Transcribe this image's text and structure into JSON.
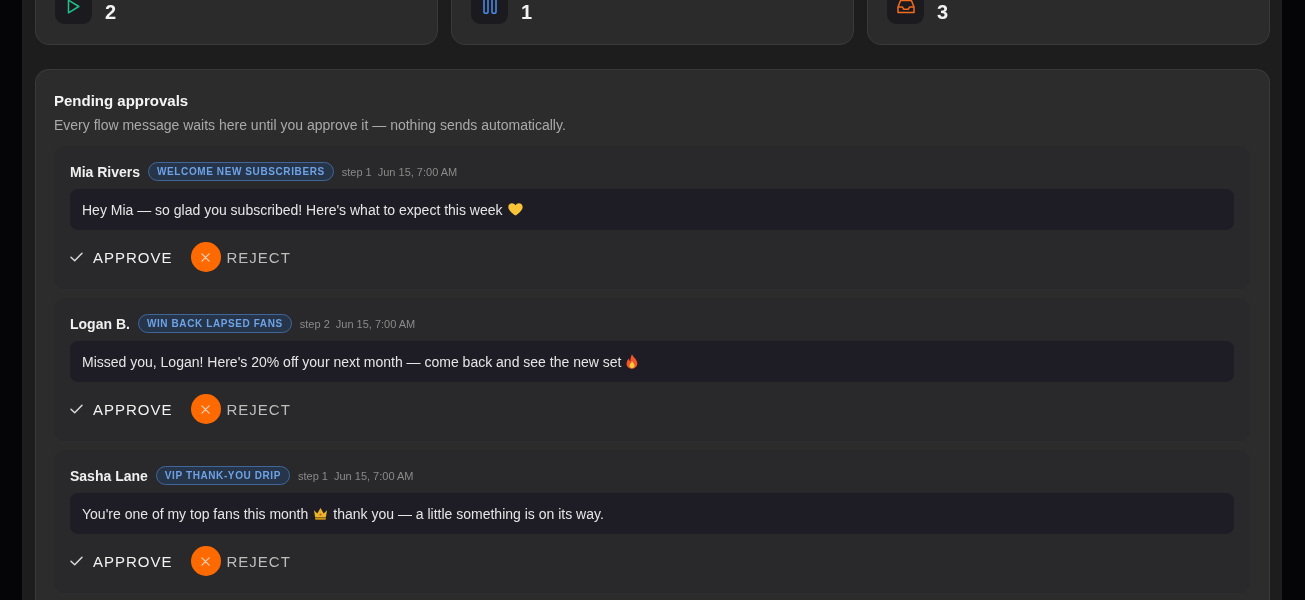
{
  "stats": [
    {
      "kind": "play",
      "value": "2"
    },
    {
      "kind": "pause",
      "value": "1"
    },
    {
      "kind": "inbox",
      "value": "3"
    }
  ],
  "pending": {
    "title": "Pending approvals",
    "subtitle": "Every flow message waits here until you approve it — nothing sends automatically.",
    "items": [
      {
        "name": "Mia Rivers",
        "flow": "WELCOME NEW SUBSCRIBERS",
        "step": "step 1",
        "time": "Jun 15, 7:00 AM",
        "message": [
          {
            "kind": "text",
            "text": "Hey Mia — so glad you subscribed! Here's what to expect this week"
          },
          {
            "kind": "heart"
          }
        ],
        "actions": [
          {
            "kind": "approve",
            "label": "APPROVE"
          },
          {
            "kind": "reject",
            "label": "REJECT"
          }
        ]
      },
      {
        "name": "Logan B.",
        "flow": "WIN BACK LAPSED FANS",
        "step": "step 2",
        "time": "Jun 15, 7:00 AM",
        "message": [
          {
            "kind": "text",
            "text": "Missed you, Logan! Here's 20% off your next month — come back and see the new set"
          },
          {
            "kind": "fire"
          }
        ],
        "actions": [
          {
            "kind": "approve",
            "label": "APPROVE"
          },
          {
            "kind": "reject",
            "label": "REJECT"
          }
        ]
      },
      {
        "name": "Sasha Lane",
        "flow": "VIP THANK-YOU DRIP",
        "step": "step 1",
        "time": "Jun 15, 7:00 AM",
        "message": [
          {
            "kind": "text",
            "text": "You're one of my top fans this month"
          },
          {
            "kind": "crown"
          },
          {
            "kind": "text",
            "text": "thank you — a little something is on its way."
          }
        ],
        "actions": [
          {
            "kind": "approve",
            "label": "APPROVE"
          },
          {
            "kind": "reject",
            "label": "REJECT"
          }
        ]
      }
    ]
  }
}
